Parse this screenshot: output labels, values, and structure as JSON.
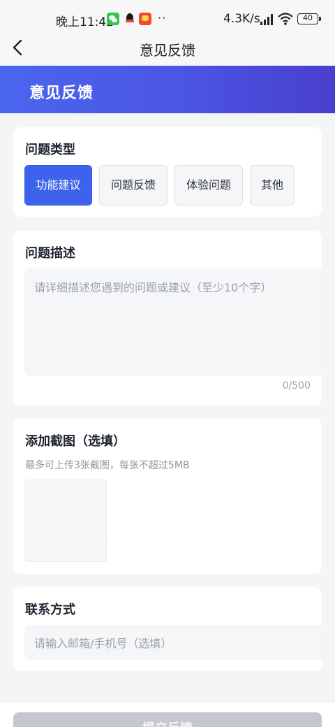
{
  "status_bar": {
    "time": "晚上11:42",
    "dots": "··",
    "network_speed": "4.3K/s",
    "battery": "40",
    "icons": [
      "wechat-icon",
      "qq-icon",
      "shop-app-icon",
      "signal-icon",
      "wifi-icon",
      "battery-icon"
    ]
  },
  "nav": {
    "back_icon": "chevron-left-icon",
    "title": "意见反馈"
  },
  "banner": {
    "title": "意见反馈",
    "gradient_start": "#4a66ef",
    "gradient_end": "#4a3fcf"
  },
  "issue_type": {
    "title": "问题类型",
    "options": [
      {
        "label": "功能建议",
        "selected": true
      },
      {
        "label": "问题反馈",
        "selected": false
      },
      {
        "label": "体验问题",
        "selected": false
      },
      {
        "label": "其他",
        "selected": false
      }
    ],
    "accent_color": "#3d62ec"
  },
  "description": {
    "title": "问题描述",
    "placeholder": "请详细描述您遇到的问题或建议（至少10个字）",
    "count": "0/500"
  },
  "screenshots": {
    "title": "添加截图（选填）",
    "hint": "最多可上传3张截图，每张不超过5MB"
  },
  "contact": {
    "title": "联系方式",
    "placeholder": "请输入邮箱/手机号（选填）"
  },
  "submit": {
    "label": "提交反馈",
    "color": "#c4c7cf"
  }
}
